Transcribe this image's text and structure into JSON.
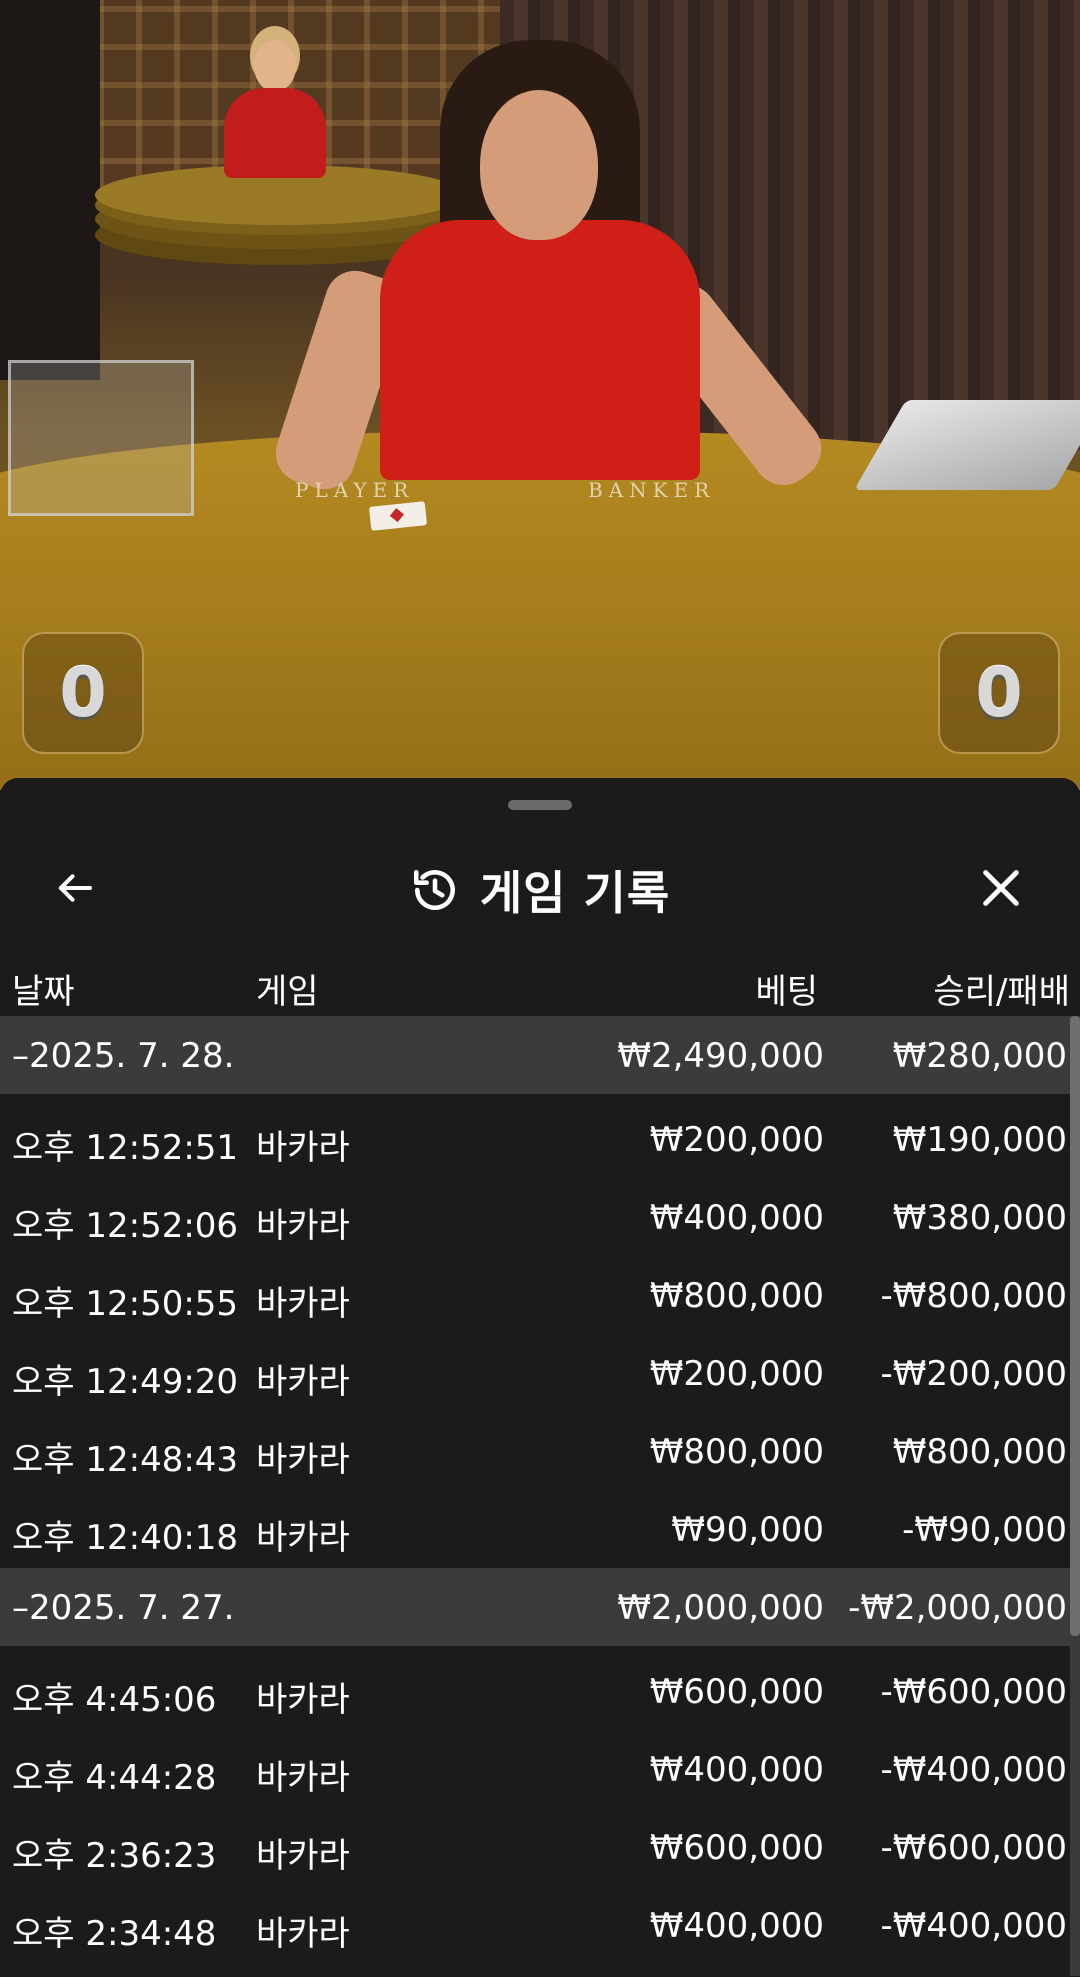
{
  "video": {
    "table_labels": {
      "player": "PLAYER",
      "banker": "BANKER"
    },
    "player_score": "0",
    "banker_score": "0"
  },
  "sheet": {
    "title": "게임 기록",
    "icons": {
      "back": "arrow-left-icon",
      "history": "history-icon",
      "close": "close-icon"
    },
    "columns": {
      "date": "날짜",
      "game": "게임",
      "bet": "베팅",
      "result": "승리/패배"
    },
    "groups": [
      {
        "date": "–2025. 7. 28.",
        "bet_total": "₩2,490,000",
        "result_total": "₩280,000",
        "rows": [
          {
            "time": "오후 12:52:51",
            "game": "바카라",
            "bet": "₩200,000",
            "result": "₩190,000"
          },
          {
            "time": "오후 12:52:06",
            "game": "바카라",
            "bet": "₩400,000",
            "result": "₩380,000"
          },
          {
            "time": "오후 12:50:55",
            "game": "바카라",
            "bet": "₩800,000",
            "result": "-₩800,000"
          },
          {
            "time": "오후 12:49:20",
            "game": "바카라",
            "bet": "₩200,000",
            "result": "-₩200,000"
          },
          {
            "time": "오후 12:48:43",
            "game": "바카라",
            "bet": "₩800,000",
            "result": "₩800,000"
          },
          {
            "time": "오후 12:40:18",
            "game": "바카라",
            "bet": "₩90,000",
            "result": "-₩90,000"
          }
        ]
      },
      {
        "date": "–2025. 7. 27.",
        "bet_total": "₩2,000,000",
        "result_total": "-₩2,000,000",
        "rows": [
          {
            "time": "오후 4:45:06",
            "game": "바카라",
            "bet": "₩600,000",
            "result": "-₩600,000"
          },
          {
            "time": "오후 4:44:28",
            "game": "바카라",
            "bet": "₩400,000",
            "result": "-₩400,000"
          },
          {
            "time": "오후 2:36:23",
            "game": "바카라",
            "bet": "₩600,000",
            "result": "-₩600,000"
          },
          {
            "time": "오후 2:34:48",
            "game": "바카라",
            "bet": "₩400,000",
            "result": "-₩400,000"
          }
        ]
      }
    ]
  }
}
